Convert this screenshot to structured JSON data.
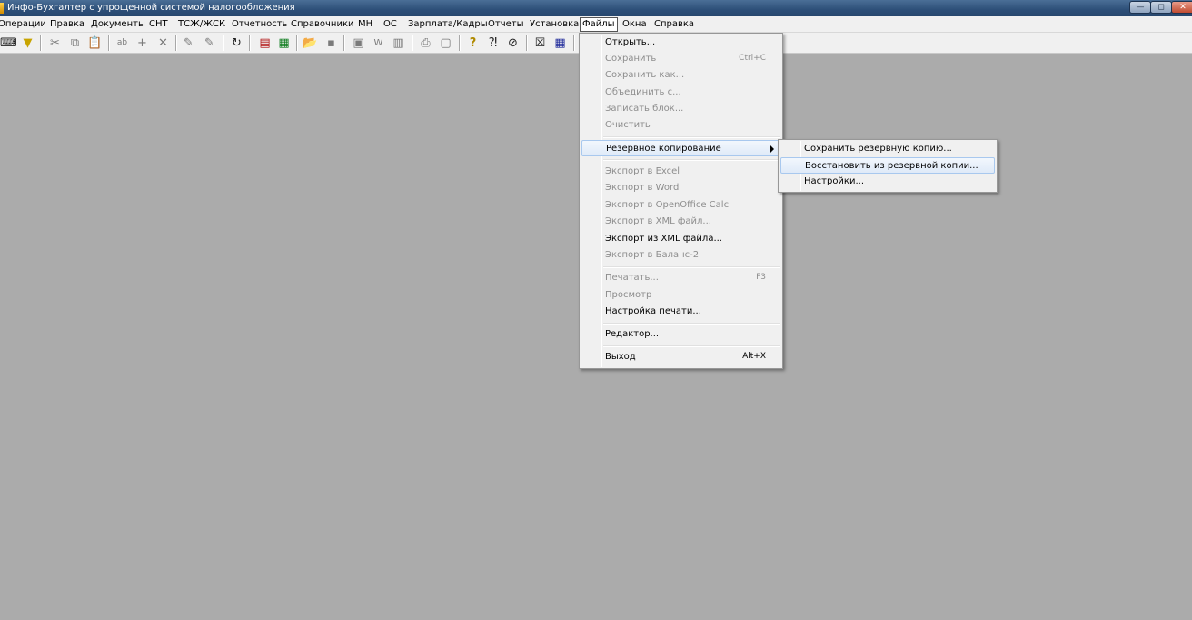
{
  "window": {
    "title": "Инфо-Бухгалтер с упрощенной системой налогообложения",
    "min_glyph": "—",
    "max_glyph": "◻",
    "close_glyph": "✕"
  },
  "menubar": {
    "items": [
      "Операции",
      "Правка",
      "Документы",
      "СНТ",
      "ТСЖ/ЖСК",
      "Отчетность",
      "Справочники",
      "МН",
      "ОС",
      "Зарплата/Кадры",
      "Отчеты",
      "Установка",
      "Файлы",
      "Окна",
      "Справка"
    ],
    "active": "Файлы"
  },
  "toolbar": {
    "icons": [
      {
        "name": "keyboard-icon",
        "glyph": "⌨",
        "enabled": true
      },
      {
        "name": "filter-icon",
        "glyph": "▼",
        "enabled": true
      },
      {
        "name": "cut-icon",
        "glyph": "✂",
        "enabled": false
      },
      {
        "name": "copy-icon",
        "glyph": "⧉",
        "enabled": false
      },
      {
        "name": "paste-icon",
        "glyph": "📋",
        "enabled": false
      },
      {
        "name": "abc-icon",
        "glyph": "ab",
        "enabled": false
      },
      {
        "name": "add-icon",
        "glyph": "+",
        "enabled": false
      },
      {
        "name": "delete-icon",
        "glyph": "✕",
        "enabled": false
      },
      {
        "name": "brush-icon",
        "glyph": "✎",
        "enabled": false
      },
      {
        "name": "brush-all-icon",
        "glyph": "✎",
        "enabled": false
      },
      {
        "name": "refresh-icon",
        "glyph": "↻",
        "enabled": true
      },
      {
        "name": "pdf-icon",
        "glyph": "▤",
        "enabled": true
      },
      {
        "name": "calculator-icon",
        "glyph": "▦",
        "enabled": true
      },
      {
        "name": "open-folder-icon",
        "glyph": "📂",
        "enabled": true
      },
      {
        "name": "save-icon",
        "glyph": "▪",
        "enabled": false
      },
      {
        "name": "export-icon",
        "glyph": "▣",
        "enabled": false
      },
      {
        "name": "word-icon",
        "glyph": "W",
        "enabled": false
      },
      {
        "name": "report-icon",
        "glyph": "▥",
        "enabled": false
      },
      {
        "name": "print-icon",
        "glyph": "⎙",
        "enabled": false
      },
      {
        "name": "preview-icon",
        "glyph": "▢",
        "enabled": false
      },
      {
        "name": "help-icon",
        "glyph": "?",
        "enabled": true
      },
      {
        "name": "context-help-icon",
        "glyph": "⁈",
        "enabled": true
      },
      {
        "name": "compass-icon",
        "glyph": "⊘",
        "enabled": true
      },
      {
        "name": "close-window-icon",
        "glyph": "☒",
        "enabled": true
      },
      {
        "name": "ms-icon",
        "glyph": "▦",
        "enabled": true
      }
    ]
  },
  "files_menu": {
    "open": "Открыть...",
    "save": "Сохранить",
    "save_shortcut": "Ctrl+C",
    "save_as": "Сохранить как...",
    "merge": "Объединить с...",
    "write_block": "Записать блок...",
    "clear": "Очистить",
    "backup": "Резервное копирование",
    "export_excel": "Экспорт в Excel",
    "export_word": "Экспорт в Word",
    "export_calc": "Экспорт в OpenOffice Calc",
    "export_xml": "Экспорт в XML файл...",
    "import_xml": "Экспорт из XML файла...",
    "export_balance": "Экспорт в Баланс-2",
    "print": "Печатать...",
    "print_shortcut": "F3",
    "preview": "Просмотр",
    "print_setup": "Настройка печати...",
    "editor": "Редактор...",
    "exit": "Выход",
    "exit_shortcut": "Alt+X"
  },
  "backup_submenu": {
    "save_backup": "Сохранить резервную копию...",
    "restore_backup": "Восстановить из резервной копии...",
    "settings": "Настройки..."
  }
}
